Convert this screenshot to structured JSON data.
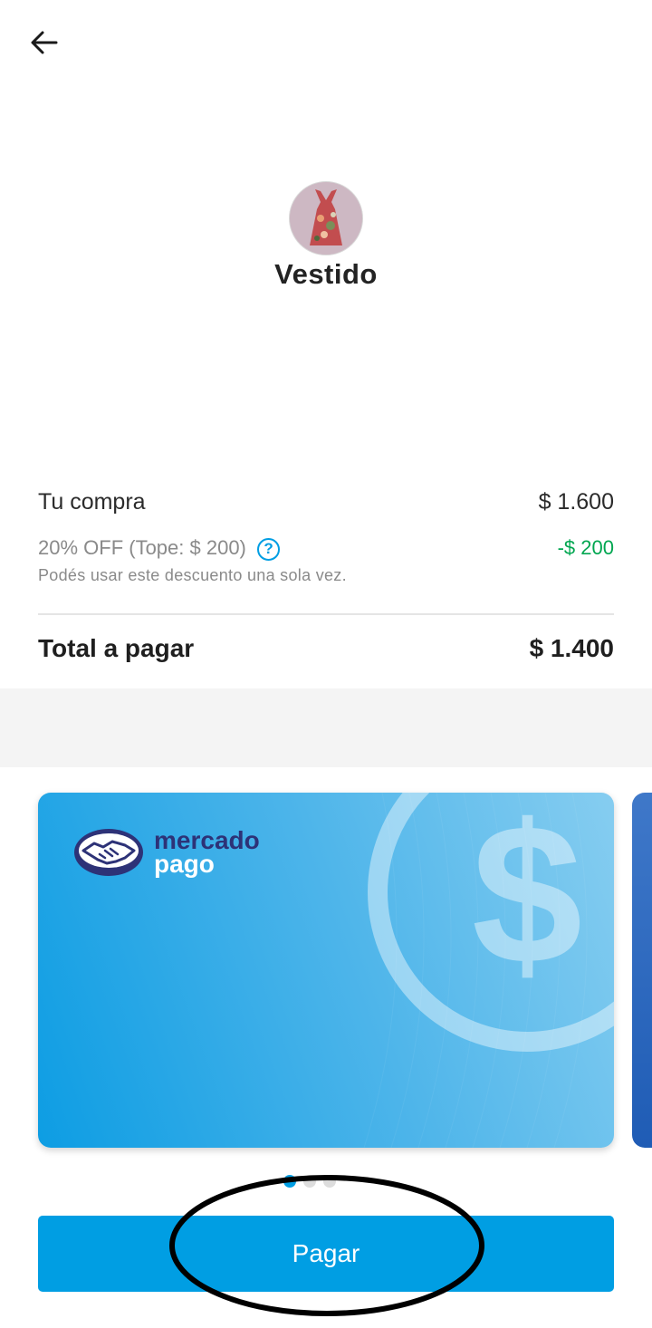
{
  "header": {
    "back_icon": "arrow-left-icon"
  },
  "product": {
    "title": "Vestido",
    "image_icon": "dress-thumbnail"
  },
  "summary": {
    "purchase_label": "Tu compra",
    "purchase_amount": "$ 1.600",
    "discount_label": "20% OFF (Tope: $ 200)",
    "discount_help_glyph": "?",
    "discount_amount": "-$ 200",
    "discount_note": "Podés usar este descuento una sola vez.",
    "total_label": "Total a pagar",
    "total_amount": "$ 1.400"
  },
  "payment_card": {
    "brand_line1": "mercado",
    "brand_line2": "pago",
    "brand_icon": "handshake-logo-icon",
    "decoration_icon": "dollar-sign-icon",
    "pager_count": 3,
    "pager_active_index": 0
  },
  "actions": {
    "pay_label": "Pagar"
  },
  "colors": {
    "accent": "#009ee3",
    "discount_green": "#00a650",
    "brand_navy": "#2d3277",
    "annotation": "#000000"
  }
}
